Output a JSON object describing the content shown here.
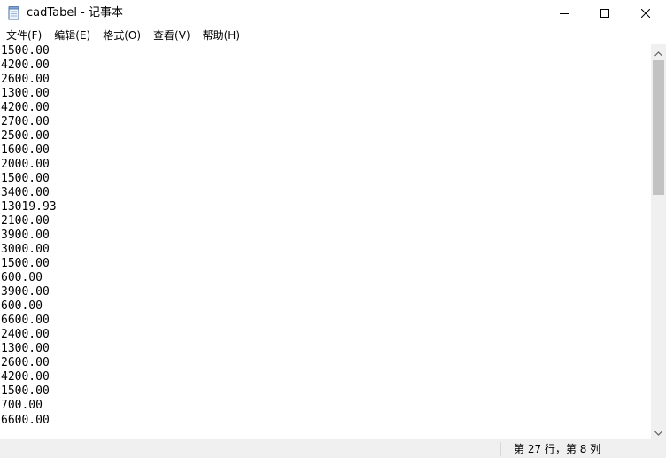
{
  "window": {
    "title": "cadTabel - 记事本"
  },
  "menu": {
    "items": [
      {
        "label": "文件(F)",
        "name": "menu-file"
      },
      {
        "label": "编辑(E)",
        "name": "menu-edit"
      },
      {
        "label": "格式(O)",
        "name": "menu-format"
      },
      {
        "label": "查看(V)",
        "name": "menu-view"
      },
      {
        "label": "帮助(H)",
        "name": "menu-help"
      }
    ]
  },
  "editor": {
    "lines": [
      "1500.00",
      "4200.00",
      "2600.00",
      "1300.00",
      "4200.00",
      "2700.00",
      "2500.00",
      "1600.00",
      "2000.00",
      "1500.00",
      "3400.00",
      "13019.93",
      "2100.00",
      "3900.00",
      "3000.00",
      "1500.00",
      "600.00",
      "3900.00",
      "600.00",
      "6600.00",
      "2400.00",
      "1300.00",
      "2600.00",
      "4200.00",
      "1500.00",
      "700.00",
      "6600.00"
    ]
  },
  "status": {
    "position": "第 27 行，第 8 列"
  },
  "icons": {
    "app": "notepad-icon",
    "minimize": "minimize-icon",
    "maximize": "maximize-icon",
    "close": "close-icon",
    "scroll_up": "chevron-up-icon",
    "scroll_down": "chevron-down-icon"
  }
}
